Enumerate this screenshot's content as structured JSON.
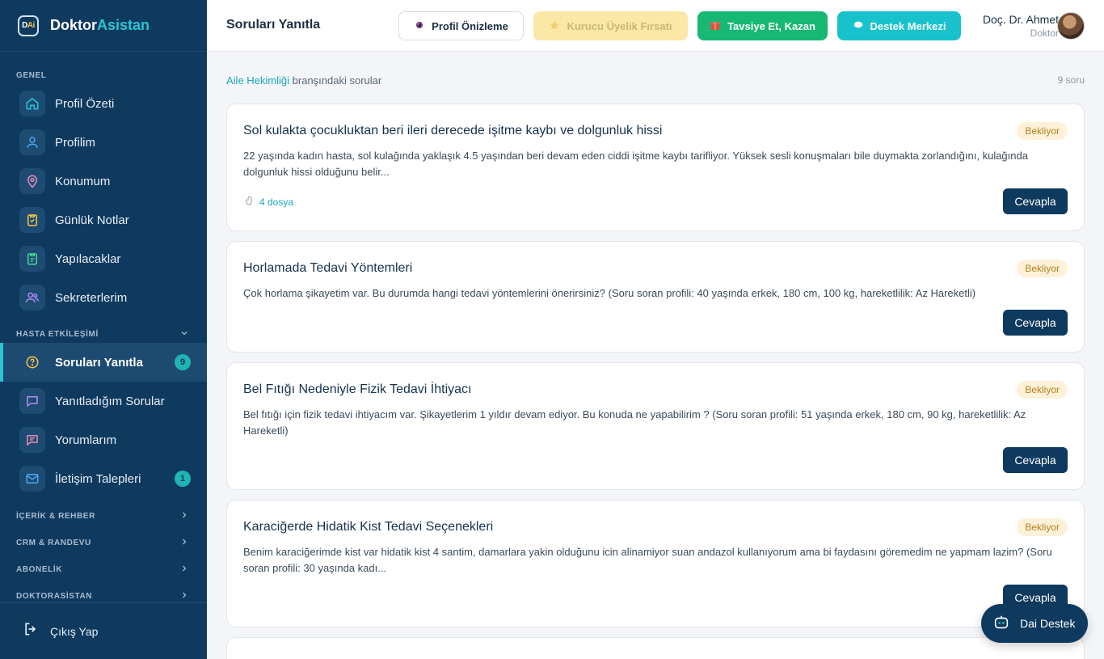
{
  "brand": {
    "mark_d": "D",
    "mark_ai": "Ai",
    "name_part1": "Doktor",
    "name_part2": "Asistan"
  },
  "sidebar": {
    "section_general": "GENEL",
    "general_items": [
      {
        "label": "Profil Özeti",
        "icon": "home-icon",
        "color": "#2bc4d3"
      },
      {
        "label": "Profilim",
        "icon": "user-icon",
        "color": "#4aa8f5"
      },
      {
        "label": "Konumum",
        "icon": "location-pin-icon",
        "color": "#e58bb7"
      },
      {
        "label": "Günlük Notlar",
        "icon": "clipboard-check-icon",
        "color": "#f5c44a"
      },
      {
        "label": "Yapılacaklar",
        "icon": "checklist-icon",
        "color": "#4cd39a"
      },
      {
        "label": "Sekreterlerim",
        "icon": "users-icon",
        "color": "#b08bf5"
      }
    ],
    "section_patient": "HASTA ETKİLEŞİMİ",
    "patient_items": [
      {
        "label": "Soruları Yanıtla",
        "icon": "question-icon",
        "color": "#f5c44a",
        "badge": "9",
        "active": true
      },
      {
        "label": "Yanıtladığım Sorular",
        "icon": "message-icon",
        "color": "#b08bf5"
      },
      {
        "label": "Yorumlarım",
        "icon": "comment-icon",
        "color": "#e58bb7"
      },
      {
        "label": "İletişim Talepleri",
        "icon": "mail-icon",
        "color": "#4aa8f5",
        "badge": "1"
      }
    ],
    "collapsed_sections": [
      "İÇERİK & REHBER",
      "CRM & RANDEVU",
      "ABONELİK",
      "DOKTORASİSTAN"
    ],
    "logout": "Çıkış Yap"
  },
  "header": {
    "title": "Soruları Yanıtla",
    "profile_preview": "Profil Önizleme",
    "founder": "Kurucu Üyelik Fırsatı",
    "refer": "Tavsiye Et, Kazan",
    "support": "Destek Merkezi",
    "user_name": "Doç. Dr. Ahmet",
    "user_role": "Doktor"
  },
  "main": {
    "branch_link": "Aile Hekimliği",
    "branch_rest": " branşındaki sorular",
    "count": "9 soru",
    "questions": [
      {
        "title": "Sol kulakta çocukluktan beri ileri derecede işitme kaybı ve dolgunluk hissi",
        "status": "Bekliyor",
        "body": "22 yaşında kadın hasta, sol kulağında yaklaşık 4.5 yaşından beri devam eden ciddi işitme kaybı tarifliyor. Yüksek sesli konuşmaları bile duymakta zorlandığını, kulağında dolgunluk hissi olduğunu belir...",
        "files": "4 dosya",
        "reply": "Cevapla"
      },
      {
        "title": "Horlamada Tedavi Yöntemleri",
        "status": "Bekliyor",
        "body": "Çok horlama şikayetim var. Bu durumda hangi tedavi yöntemlerini önerirsiniz? (Soru soran profili: 40 yaşında erkek, 180 cm, 100 kg, hareketlilik: Az Hareketli)",
        "reply": "Cevapla"
      },
      {
        "title": "Bel Fıtığı Nedeniyle Fizik Tedavi İhtiyacı",
        "status": "Bekliyor",
        "body": "Bel fıtığı için fizik tedavi ihtiyacım var. Şikayetlerim 1 yıldır devam ediyor. Bu konuda ne yapabilirim ? (Soru soran profili: 51 yaşında erkek, 180 cm, 90 kg, hareketlilik: Az Hareketli)",
        "reply": "Cevapla"
      },
      {
        "title": "Karaciğerde Hidatik Kist Tedavi Seçenekleri",
        "status": "Bekliyor",
        "body": "Benim karaciğerimde kist var hidatik kist 4 santim, damarlara yakin olduğunu icin alinamiyor suan andazol kullanıyorum ama bi faydasını göremedim ne yapmam lazim? (Soru soran profili: 30 yaşında kadı...",
        "reply": "Cevapla"
      }
    ]
  },
  "dai_support": "Dai Destek"
}
